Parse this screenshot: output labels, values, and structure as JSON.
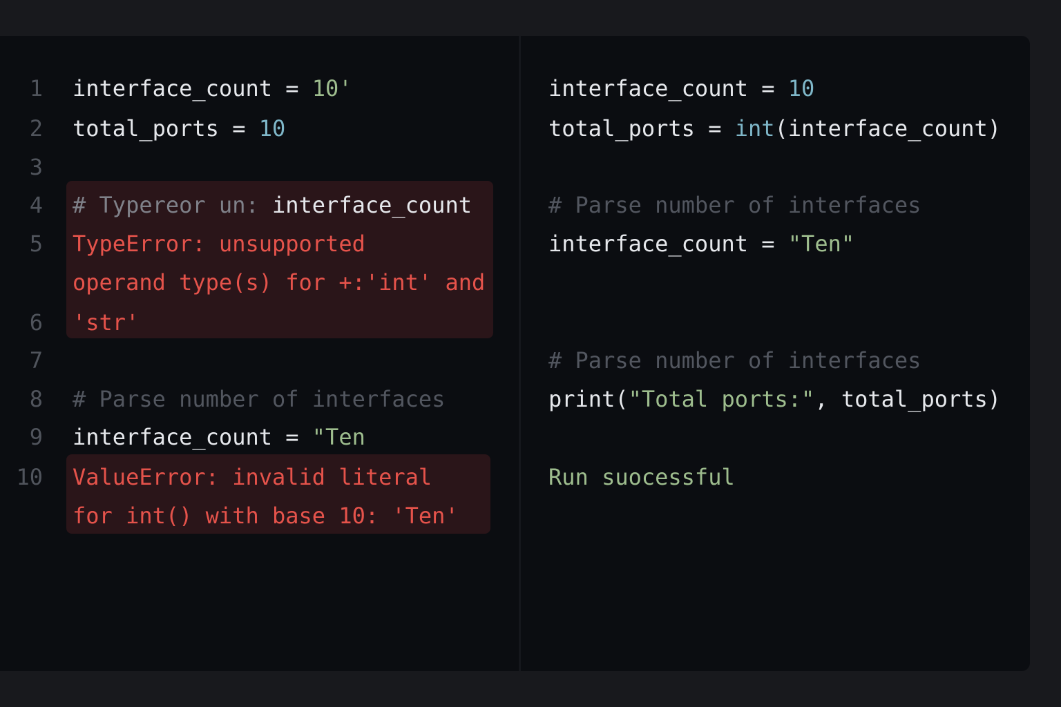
{
  "left_pane": {
    "line_numbers": [
      "1",
      "2",
      "3",
      "4",
      "5",
      "6",
      "7",
      "8",
      "9",
      "10"
    ],
    "line1": {
      "code": "interface_count = ",
      "value": "10'"
    },
    "line2": {
      "code": "total_ports = ",
      "value": "10"
    },
    "line4": {
      "comment": "# Typereor un: ",
      "code": "interface_count"
    },
    "type_error": {
      "line1": "TypeError: unsupported",
      "line2": "operand type(s) for +:'int' and",
      "line3": "'str'"
    },
    "line8": {
      "comment": "# Parse number of interfaces"
    },
    "line9": {
      "code": "interface_count = ",
      "value": "\"Ten"
    },
    "value_error": {
      "line1": "ValueError: invalid literal",
      "line2": "for int() with base 10: 'Ten'"
    }
  },
  "right_pane": {
    "line1": {
      "code": "interface_count = ",
      "value": "10"
    },
    "line2": {
      "code_a": "total_ports = ",
      "fn": "int",
      "code_b": "(interface_count)"
    },
    "comment1": "# Parse number of interfaces",
    "line4": {
      "code": "interface_count = ",
      "value": "\"Ten\""
    },
    "comment2": "# Parse number of interfaces",
    "line6": {
      "code_a": "print(",
      "str": "\"Total ports:\"",
      "code_b": ", total_ports)"
    },
    "status": "Run suocessful"
  }
}
